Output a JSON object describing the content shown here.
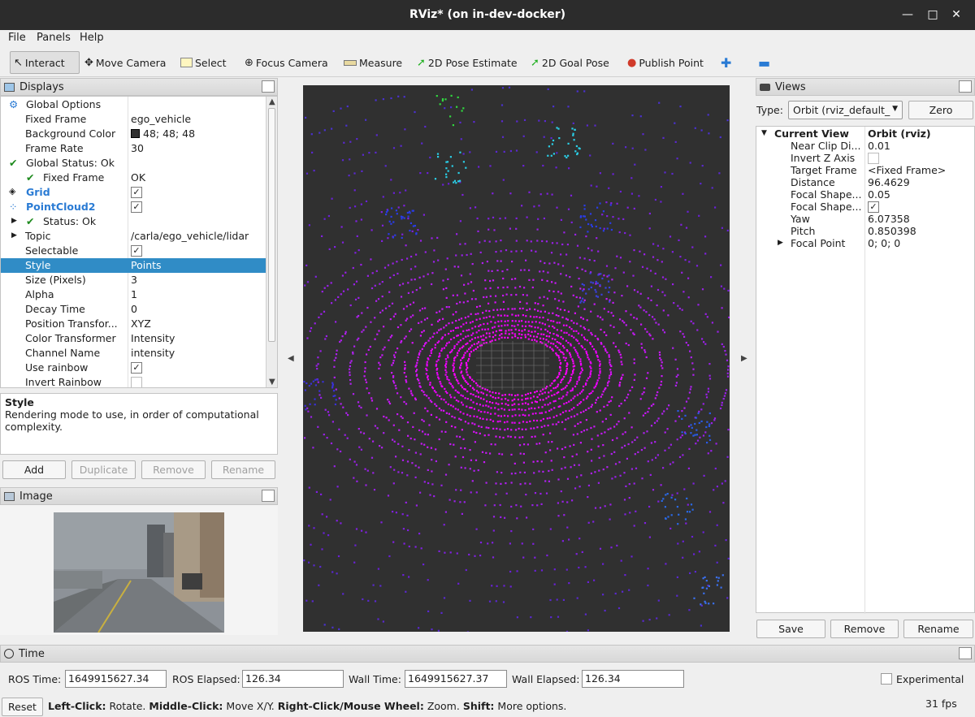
{
  "window": {
    "title": "RViz* (on in-dev-docker)"
  },
  "menu": [
    "File",
    "Panels",
    "Help"
  ],
  "toolbar": {
    "interact": "Interact",
    "move_camera": "Move Camera",
    "select": "Select",
    "focus_camera": "Focus Camera",
    "measure": "Measure",
    "pose_estimate": "2D Pose Estimate",
    "goal_pose": "2D Goal Pose",
    "publish_point": "Publish Point"
  },
  "displays": {
    "title": "Displays",
    "rows": [
      {
        "k": "Global Options",
        "v": ""
      },
      {
        "k": "Fixed Frame",
        "v": "ego_vehicle"
      },
      {
        "k": "Background Color",
        "v": "48; 48; 48"
      },
      {
        "k": "Frame Rate",
        "v": "30"
      },
      {
        "k": "Global Status: Ok",
        "v": ""
      },
      {
        "k": "Fixed Frame",
        "v": "OK"
      },
      {
        "k": "Grid",
        "v": ""
      },
      {
        "k": "PointCloud2",
        "v": ""
      },
      {
        "k": "Status: Ok",
        "v": ""
      },
      {
        "k": "Topic",
        "v": "/carla/ego_vehicle/lidar"
      },
      {
        "k": "Selectable",
        "v": ""
      },
      {
        "k": "Style",
        "v": "Points"
      },
      {
        "k": "Size (Pixels)",
        "v": "3"
      },
      {
        "k": "Alpha",
        "v": "1"
      },
      {
        "k": "Decay Time",
        "v": "0"
      },
      {
        "k": "Position Transfor...",
        "v": "XYZ"
      },
      {
        "k": "Color Transformer",
        "v": "Intensity"
      },
      {
        "k": "Channel Name",
        "v": "intensity"
      },
      {
        "k": "Use rainbow",
        "v": ""
      },
      {
        "k": "Invert Rainbow",
        "v": ""
      }
    ]
  },
  "description": {
    "title": "Style",
    "text": "Rendering mode to use, in order of computational complexity."
  },
  "display_buttons": {
    "add": "Add",
    "duplicate": "Duplicate",
    "remove": "Remove",
    "rename": "Rename"
  },
  "image_panel": {
    "title": "Image"
  },
  "views": {
    "title": "Views",
    "type_label": "Type:",
    "type_value": "Orbit (rviz_default_",
    "zero": "Zero",
    "rows": [
      {
        "k": "Current View",
        "v": "Orbit (rviz)"
      },
      {
        "k": "Near Clip Di...",
        "v": "0.01"
      },
      {
        "k": "Invert Z Axis",
        "v": ""
      },
      {
        "k": "Target Frame",
        "v": "<Fixed Frame>"
      },
      {
        "k": "Distance",
        "v": "96.4629"
      },
      {
        "k": "Focal Shape...",
        "v": "0.05"
      },
      {
        "k": "Focal Shape...",
        "v": ""
      },
      {
        "k": "Yaw",
        "v": "6.07358"
      },
      {
        "k": "Pitch",
        "v": "0.850398"
      },
      {
        "k": "Focal Point",
        "v": "0; 0; 0"
      }
    ],
    "save": "Save",
    "remove": "Remove",
    "rename": "Rename"
  },
  "time": {
    "title": "Time",
    "ros_time_label": "ROS Time:",
    "ros_time": "1649915627.34",
    "ros_elapsed_label": "ROS Elapsed:",
    "ros_elapsed": "126.34",
    "wall_time_label": "Wall Time:",
    "wall_time": "1649915627.37",
    "wall_elapsed_label": "Wall Elapsed:",
    "wall_elapsed": "126.34",
    "experimental": "Experimental"
  },
  "status": {
    "reset": "Reset",
    "left": "Left-Click:",
    "left_t": "Rotate.",
    "middle": "Middle-Click:",
    "middle_t": "Move X/Y.",
    "right": "Right-Click/Mouse Wheel:",
    "right_t": "Zoom.",
    "shift": "Shift:",
    "shift_t": "More options.",
    "fps": "31 fps"
  },
  "colors": {
    "accent": "#308cc6",
    "viewport_bg": "#303030",
    "titlebar": "#2c2c2c"
  }
}
